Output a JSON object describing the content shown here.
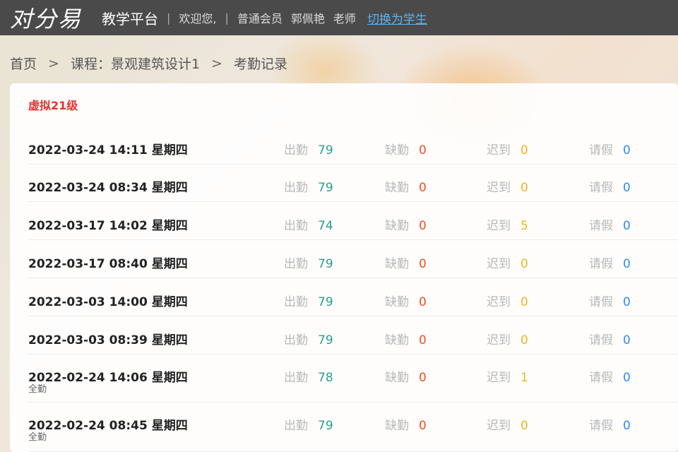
{
  "header": {
    "logo": "对分易",
    "platform": "教学平台",
    "separator": "|",
    "welcome": "欢迎您,",
    "member_type": "普通会员",
    "user_name": "郭佩艳",
    "role": "老师",
    "switch_label": "切换为学生"
  },
  "breadcrumb": {
    "home": "首页",
    "sep": ">",
    "course": "课程：景观建筑设计1",
    "current": "考勤记录"
  },
  "class_name": "虚拟21级",
  "labels": {
    "present": "出勤",
    "absent": "缺勤",
    "late": "迟到",
    "leave": "请假"
  },
  "records": [
    {
      "datetime": "2022-03-24 14:11 星期四",
      "note": "",
      "present": "79",
      "absent": "0",
      "late": "0",
      "leave": "0"
    },
    {
      "datetime": "2022-03-24 08:34 星期四",
      "note": "",
      "present": "79",
      "absent": "0",
      "late": "0",
      "leave": "0"
    },
    {
      "datetime": "2022-03-17 14:02 星期四",
      "note": "",
      "present": "74",
      "absent": "0",
      "late": "5",
      "leave": "0"
    },
    {
      "datetime": "2022-03-17 08:40 星期四",
      "note": "",
      "present": "79",
      "absent": "0",
      "late": "0",
      "leave": "0"
    },
    {
      "datetime": "2022-03-03 14:00 星期四",
      "note": "",
      "present": "79",
      "absent": "0",
      "late": "0",
      "leave": "0"
    },
    {
      "datetime": "2022-03-03 08:39 星期四",
      "note": "",
      "present": "79",
      "absent": "0",
      "late": "0",
      "leave": "0"
    },
    {
      "datetime": "2022-02-24 14:06 星期四",
      "note": "全勤",
      "present": "78",
      "absent": "0",
      "late": "1",
      "leave": "0"
    },
    {
      "datetime": "2022-02-24 08:45 星期四",
      "note": "全勤",
      "present": "79",
      "absent": "0",
      "late": "0",
      "leave": "0"
    }
  ],
  "colors": {
    "topbar": "#4a4a4a",
    "class_name": "#e2332f",
    "present": "#2a9d8f",
    "absent": "#f04e23",
    "late": "#f0b323",
    "leave": "#2d8cf0",
    "link": "#5ab3f0"
  }
}
